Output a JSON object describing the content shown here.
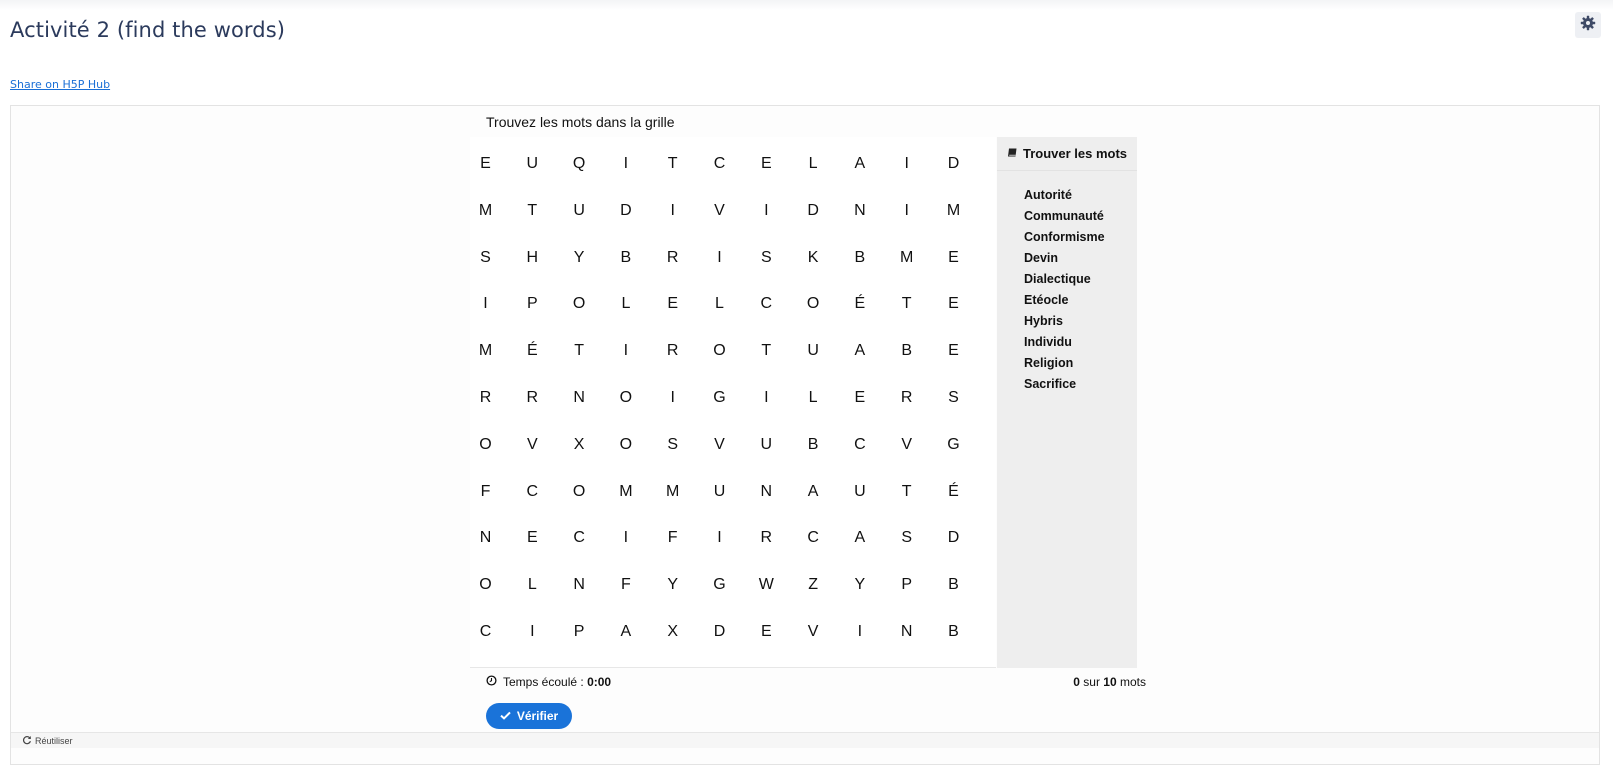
{
  "page": {
    "title": "Activité 2 (find the words)",
    "share_link": "Share on H5P Hub",
    "settings_icon": "gear-icon"
  },
  "activity": {
    "instructions": "Trouvez les mots dans la grille",
    "grid": [
      [
        "E",
        "U",
        "Q",
        "I",
        "T",
        "C",
        "E",
        "L",
        "A",
        "I",
        "D"
      ],
      [
        "M",
        "T",
        "U",
        "D",
        "I",
        "V",
        "I",
        "D",
        "N",
        "I",
        "M"
      ],
      [
        "S",
        "H",
        "Y",
        "B",
        "R",
        "I",
        "S",
        "K",
        "B",
        "M",
        "E"
      ],
      [
        "I",
        "P",
        "O",
        "L",
        "E",
        "L",
        "C",
        "O",
        "É",
        "T",
        "E"
      ],
      [
        "M",
        "É",
        "T",
        "I",
        "R",
        "O",
        "T",
        "U",
        "A",
        "B",
        "E"
      ],
      [
        "R",
        "R",
        "N",
        "O",
        "I",
        "G",
        "I",
        "L",
        "E",
        "R",
        "S"
      ],
      [
        "O",
        "V",
        "X",
        "O",
        "S",
        "V",
        "U",
        "B",
        "C",
        "V",
        "G"
      ],
      [
        "F",
        "C",
        "O",
        "M",
        "M",
        "U",
        "N",
        "A",
        "U",
        "T",
        "É"
      ],
      [
        "N",
        "E",
        "C",
        "I",
        "F",
        "I",
        "R",
        "C",
        "A",
        "S",
        "D"
      ],
      [
        "O",
        "L",
        "N",
        "F",
        "Y",
        "G",
        "W",
        "Z",
        "Y",
        "P",
        "B"
      ],
      [
        "C",
        "I",
        "P",
        "A",
        "X",
        "D",
        "E",
        "V",
        "I",
        "N",
        "B"
      ]
    ],
    "words_panel": {
      "title": "Trouver les mots",
      "icon": "book-icon",
      "words": [
        "Autorité",
        "Communauté",
        "Conformisme",
        "Devin",
        "Dialectique",
        "Etéocle",
        "Hybris",
        "Individu",
        "Religion",
        "Sacrifice"
      ]
    },
    "timer": {
      "icon": "clock-icon",
      "label": "Temps écoulé :",
      "value": "0:00"
    },
    "counter": {
      "found": "0",
      "between": "sur",
      "total": "10",
      "unit": "mots"
    },
    "check_button": {
      "label": "Vérifier",
      "icon": "check-icon",
      "color": "#1a73d9"
    },
    "reuse_button": {
      "label": "Réutiliser",
      "icon": "refresh-icon"
    }
  }
}
